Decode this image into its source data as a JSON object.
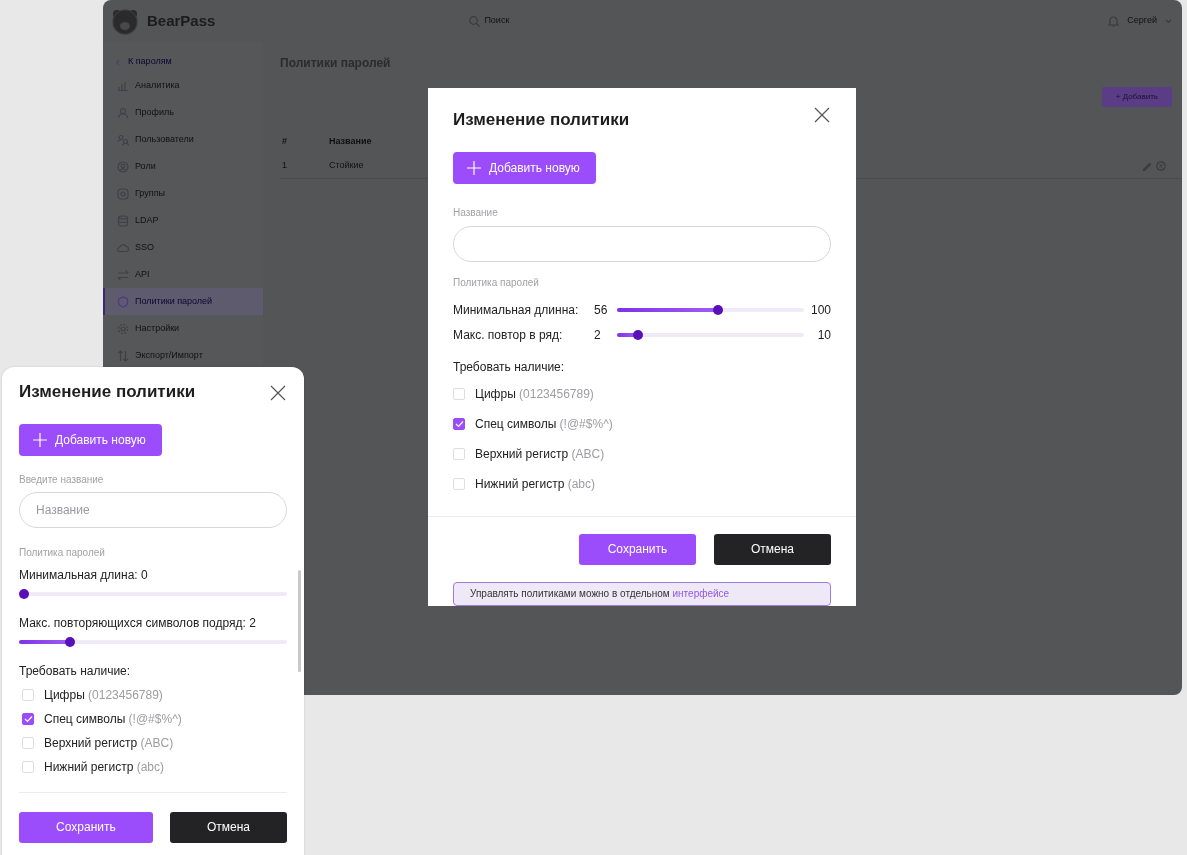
{
  "app": {
    "logo": "BearPass",
    "search": {
      "placeholder": "Поиск"
    },
    "user": "Сергей",
    "sidebar": {
      "back": "К паролям",
      "items": [
        {
          "label": "Аналитика",
          "selected": false
        },
        {
          "label": "Профиль",
          "selected": false
        },
        {
          "label": "Пользователи",
          "selected": false
        },
        {
          "label": "Роли",
          "selected": false
        },
        {
          "label": "Группы",
          "selected": false
        },
        {
          "label": "LDAP",
          "selected": false
        },
        {
          "label": "SSO",
          "selected": false
        },
        {
          "label": "API",
          "selected": false
        },
        {
          "label": "Политики паролей",
          "selected": true
        },
        {
          "label": "Настройки",
          "selected": false
        },
        {
          "label": "Экспорт/Импорт",
          "selected": false
        }
      ]
    },
    "page": {
      "title": "Политики паролей",
      "add_button": "+ Добавить",
      "table": {
        "columns": [
          "#",
          "Название"
        ],
        "rows": [
          [
            "1",
            "Стойкие"
          ]
        ]
      }
    }
  },
  "modal": {
    "title": "Изменение политики",
    "add_button": "Добавить новую",
    "name_label": "Название",
    "policy_label": "Политика паролей",
    "sliders": [
      {
        "label": "Минимальная длинна:",
        "value": "56",
        "max": "100",
        "level": 0.54
      },
      {
        "label": "Макс. повтор в ряд:",
        "value": "2",
        "max": "10",
        "level": 0.11
      }
    ],
    "require_label": "Требовать наличие:",
    "checks": [
      {
        "label": "Цифры",
        "hint": "(0123456789)",
        "checked": false
      },
      {
        "label": "Спец символы",
        "hint": "(!@#$%^)",
        "checked": true
      },
      {
        "label": "Верхний регистр",
        "hint": "(ABC)",
        "checked": false
      },
      {
        "label": "Нижний регистр",
        "hint": "(abc)",
        "checked": false
      }
    ],
    "buttons": [
      "Сохранить",
      "Отмена"
    ],
    "note": {
      "text": "Управлять политиками можно в отдельном",
      "link": "интерфейсе"
    }
  },
  "mobile_panel": {
    "title": "Изменение политики",
    "add_button": "Добавить новую",
    "name_label": "Введите название",
    "name_field": {
      "placeholder": "Название"
    },
    "policy_label": "Политика паролей",
    "sliders": [
      {
        "label": "Минимальная длина: 0",
        "level": 0
      },
      {
        "label": "Макс. повторяющихся символов подряд: 2",
        "level": 0.19
      }
    ],
    "require_label": "Требовать наличие:",
    "checks": [
      {
        "label": "Цифры",
        "hint": "(0123456789)",
        "checked": false
      },
      {
        "label": "Спец символы",
        "hint": "(!@#$%^)",
        "checked": true
      },
      {
        "label": "Верхний регистр",
        "hint": "(ABC)",
        "checked": false
      },
      {
        "label": "Нижний регистр",
        "hint": "(abc)",
        "checked": false
      }
    ],
    "buttons": [
      "Сохранить",
      "Отмена"
    ]
  }
}
